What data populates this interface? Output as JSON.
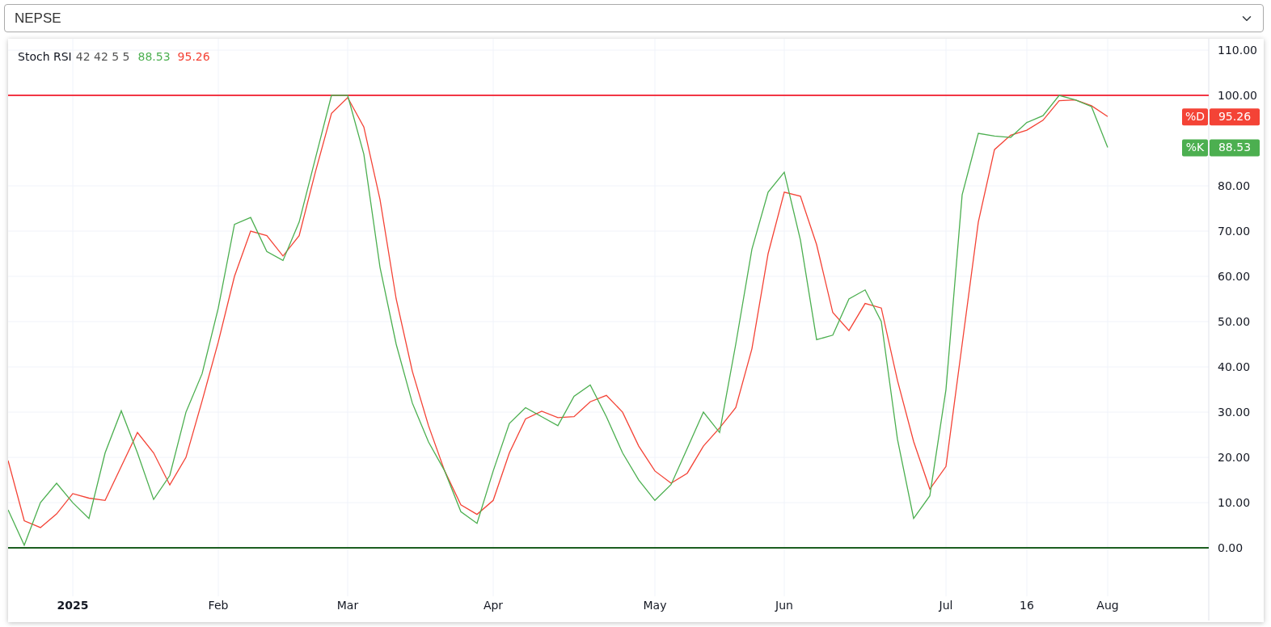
{
  "symbol_select": {
    "value": "NEPSE"
  },
  "chart": {
    "legend": {
      "params": "42 42 5 5",
      "values": [
        {
          "text": "88.53",
          "color": "#4caf50"
        },
        {
          "text": "95.26",
          "color": "#f44336"
        }
      ]
    },
    "price_tags": [
      {
        "text": "95.26"
      },
      {
        "text": "88.53"
      }
    ],
    "first_x_label_bold": true,
    "chart_data": {
      "type": "line",
      "title": "Stoch RSI",
      "grid": true,
      "legend": "right",
      "categories": [
        null,
        null,
        null,
        null,
        "2025",
        null,
        null,
        null,
        null,
        null,
        null,
        null,
        null,
        "Feb",
        null,
        null,
        null,
        null,
        null,
        null,
        null,
        "Mar",
        null,
        null,
        null,
        null,
        null,
        null,
        null,
        null,
        "Apr",
        null,
        null,
        null,
        null,
        null,
        null,
        null,
        null,
        null,
        "May",
        null,
        null,
        null,
        null,
        null,
        null,
        null,
        "Jun",
        null,
        null,
        null,
        null,
        null,
        null,
        null,
        null,
        null,
        "Jul",
        null,
        null,
        null,
        null,
        "16",
        null,
        null,
        null,
        null,
        "Aug"
      ],
      "series": [
        {
          "name": "%D",
          "color": "#f44336",
          "values": [
            19.3,
            6,
            4.5,
            7.5,
            12,
            11,
            10.5,
            18,
            25.5,
            21,
            13.9,
            20,
            32.5,
            45.5,
            60,
            70,
            69,
            64.5,
            69,
            83,
            96,
            99.5,
            93,
            77,
            55,
            39,
            27,
            17,
            9.5,
            7.4,
            10.5,
            21,
            28.5,
            30.2,
            28.8,
            29,
            32.3,
            33.7,
            30,
            22.5,
            17,
            14.3,
            16.5,
            22.5,
            26.5,
            31,
            44,
            65,
            78.6,
            77.7,
            67,
            52,
            48,
            54,
            53,
            37,
            23.5,
            13,
            18,
            45,
            72,
            88,
            91.2,
            92.3,
            94.5,
            98.8,
            99,
            97.7,
            95.3
          ]
        },
        {
          "name": "%K",
          "color": "#4caf50",
          "values": [
            8.4,
            0.6,
            10,
            14.3,
            10,
            6.5,
            21,
            30.3,
            21,
            10.7,
            16,
            30,
            38.5,
            53,
            71.5,
            73,
            65.5,
            63.5,
            72,
            86,
            100,
            100,
            87,
            62,
            45,
            32,
            23.4,
            17,
            8,
            5.4,
            17,
            27.5,
            31,
            29,
            27,
            33.5,
            36,
            29,
            21,
            15,
            10.5,
            14,
            22,
            30,
            25.5,
            45,
            66,
            78.6,
            83,
            68,
            46,
            47,
            55,
            57,
            50,
            24,
            6.5,
            11.5,
            35,
            78,
            91.6,
            91,
            90.7,
            94,
            95.5,
            100,
            99,
            97.5,
            88.5
          ]
        }
      ],
      "ylim": [
        -10.7,
        112.5
      ],
      "yticks": [
        {
          "value": 0,
          "label": "0.00"
        },
        {
          "value": 10,
          "label": "10.00"
        },
        {
          "value": 20,
          "label": "20.00"
        },
        {
          "value": 30,
          "label": "30.00"
        },
        {
          "value": 40,
          "label": "40.00"
        },
        {
          "value": 50,
          "label": "50.00"
        },
        {
          "value": 60,
          "label": "60.00"
        },
        {
          "value": 70,
          "label": "70.00"
        },
        {
          "value": 80,
          "label": "80.00"
        },
        {
          "value": 100,
          "label": "100.00"
        },
        {
          "value": 110,
          "label": "110.00"
        }
      ],
      "ref_lines": [
        {
          "axis": "y",
          "value": 100,
          "color": "#f23645"
        },
        {
          "axis": "y",
          "value": 0,
          "color": "#1b5e20"
        }
      ]
    }
  }
}
